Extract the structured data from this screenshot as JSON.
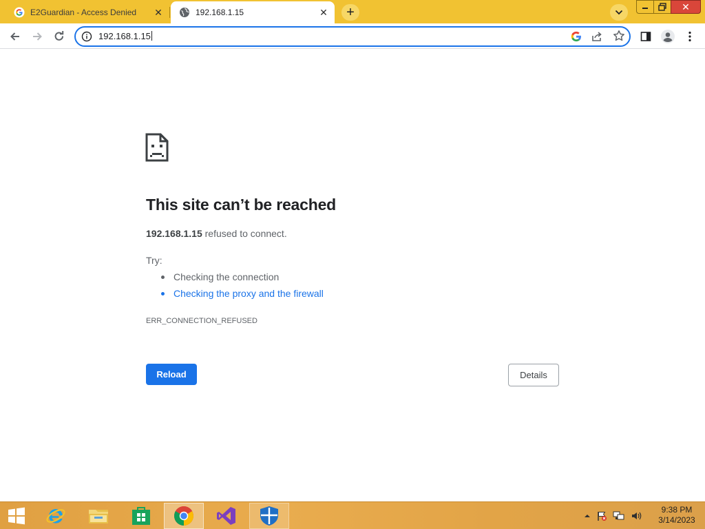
{
  "browser": {
    "tabs": [
      {
        "title": "E2Guardian - Access Denied",
        "active": false,
        "favicon": "google-g-icon"
      },
      {
        "title": "192.168.1.15",
        "active": true,
        "favicon": "globe-icon"
      }
    ],
    "new_tab_label": "+",
    "close_glyph": "✕",
    "omnibox": {
      "url": "192.168.1.15"
    },
    "theme_color": "#f1c232",
    "accent_color": "#1a73e8"
  },
  "error_page": {
    "title": "This site can’t be reached",
    "host": "192.168.1.15",
    "message": "refused to connect.",
    "try_label": "Try:",
    "suggestions": [
      {
        "text": "Checking the connection",
        "link": false
      },
      {
        "text": "Checking the proxy and the firewall",
        "link": true
      }
    ],
    "error_code": "ERR_CONNECTION_REFUSED",
    "reload_label": "Reload",
    "details_label": "Details"
  },
  "taskbar": {
    "apps": [
      "start-icon",
      "internet-explorer-icon",
      "file-explorer-icon",
      "store-icon",
      "chrome-icon",
      "visual-studio-icon",
      "defender-icon"
    ],
    "active_app": "chrome-icon",
    "clock": {
      "time": "9:38 PM",
      "date": "3/14/2023"
    }
  }
}
